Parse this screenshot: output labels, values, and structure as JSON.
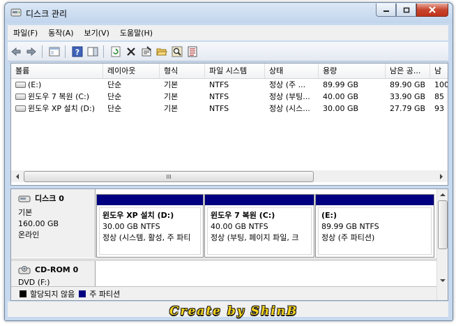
{
  "window": {
    "title": "디스크 관리"
  },
  "menu": [
    "파일(F)",
    "동작(A)",
    "보기(V)",
    "도움말(H)"
  ],
  "volume_table": {
    "columns": [
      "볼륨",
      "레이아웃",
      "형식",
      "파일 시스템",
      "상태",
      "용량",
      "남은 공...",
      "남"
    ],
    "rows": [
      [
        "(E:)",
        "단순",
        "기본",
        "NTFS",
        "정상 (주 ...",
        "89.99 GB",
        "89.90 GB",
        "100"
      ],
      [
        "윈도우 7 복원 (C:)",
        "단순",
        "기본",
        "NTFS",
        "정상 (부팅...",
        "40.00 GB",
        "33.90 GB",
        "85"
      ],
      [
        "윈도우 XP 설치 (D:)",
        "단순",
        "기본",
        "NTFS",
        "정상 (시스...",
        "30.00 GB",
        "27.79 GB",
        "93"
      ]
    ],
    "scroll_grip": "III"
  },
  "disks": [
    {
      "title": "디스크 0",
      "type": "기본",
      "size": "160.00 GB",
      "status": "온라인",
      "partitions": [
        {
          "name": "윈도우 XP 설치  (D:)",
          "size": "30.00 GB NTFS",
          "status": "정상 (시스템, 활성, 주 파티"
        },
        {
          "name": "윈도우 7 복원  (C:)",
          "size": "40.00 GB NTFS",
          "status": "정상 (부팅, 페이지 파일, 크"
        },
        {
          "name": "(E:)",
          "size": "89.99 GB NTFS",
          "status": "정상 (주 파티션)"
        }
      ]
    },
    {
      "title": "CD-ROM 0",
      "type": "DVD (F:)"
    }
  ],
  "legend": [
    {
      "label": "할당되지 않음",
      "color": "#000000"
    },
    {
      "label": "주 파티션",
      "color": "#000080"
    }
  ],
  "colors": {
    "primary_partition": "#000080",
    "title_bar": "#c7d9ee"
  },
  "watermark": "Create by ShinB"
}
